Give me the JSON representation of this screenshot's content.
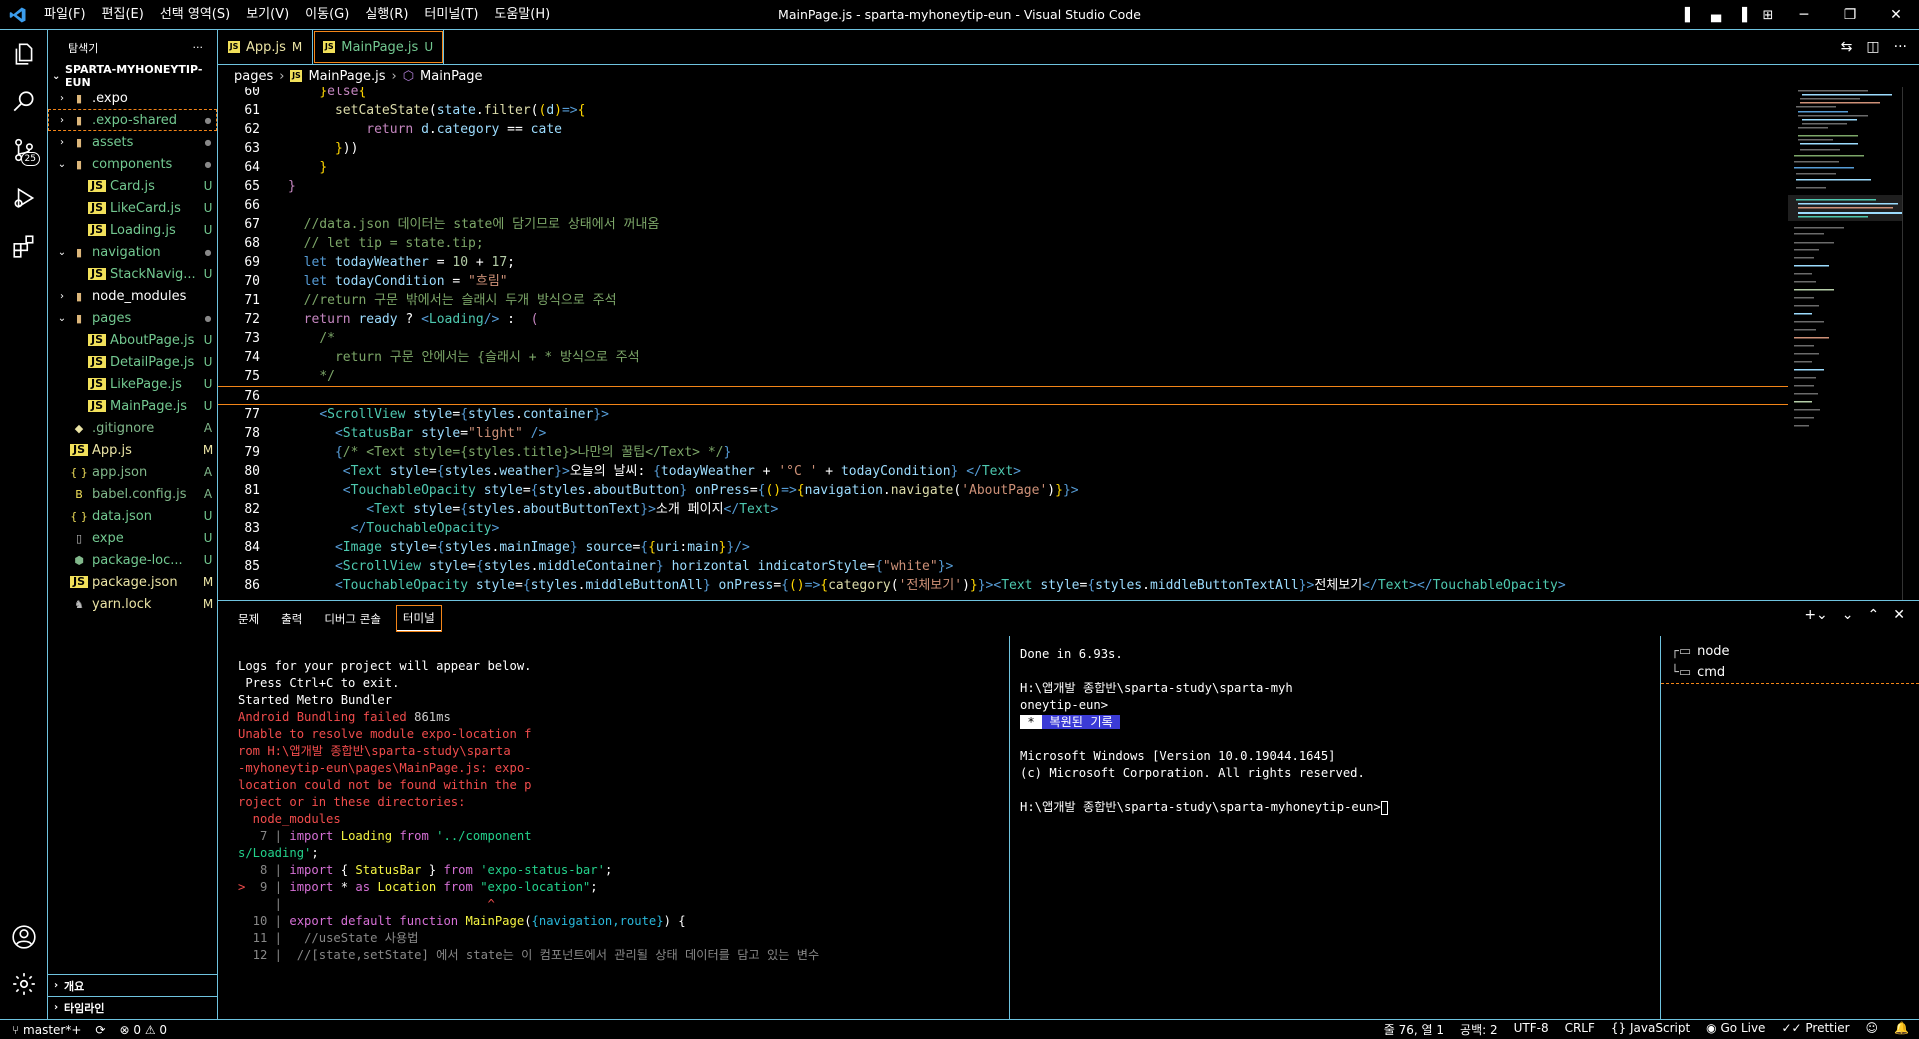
{
  "window": {
    "title": "MainPage.js - sparta-myhoneytip-eun - Visual Studio Code",
    "menu": [
      "파일(F)",
      "편집(E)",
      "선택 영역(S)",
      "보기(V)",
      "이동(G)",
      "실행(R)",
      "터미널(T)",
      "도움말(H)"
    ]
  },
  "activity": {
    "scm_badge": "25"
  },
  "explorer": {
    "title": "탐색기",
    "more": "···",
    "project": "SPARTA-MYHONEYTIP-EUN",
    "items": [
      {
        "name": ".expo",
        "kind": "folder",
        "depth": 0,
        "open": false,
        "status": ""
      },
      {
        "name": ".expo-shared",
        "kind": "folder",
        "depth": 0,
        "open": false,
        "status": "●"
      },
      {
        "name": "assets",
        "kind": "folder",
        "depth": 0,
        "open": false,
        "status": "●"
      },
      {
        "name": "components",
        "kind": "folder",
        "depth": 0,
        "open": true,
        "status": "●"
      },
      {
        "name": "Card.js",
        "kind": "js",
        "depth": 1,
        "status": "U"
      },
      {
        "name": "LikeCard.js",
        "kind": "js",
        "depth": 1,
        "status": "U"
      },
      {
        "name": "Loading.js",
        "kind": "js",
        "depth": 1,
        "status": "U"
      },
      {
        "name": "navigation",
        "kind": "folder",
        "depth": 0,
        "open": true,
        "status": "●"
      },
      {
        "name": "StackNavig...",
        "kind": "js",
        "depth": 1,
        "status": "U"
      },
      {
        "name": "node_modules",
        "kind": "folder",
        "depth": 0,
        "open": false,
        "status": ""
      },
      {
        "name": "pages",
        "kind": "folder",
        "depth": 0,
        "open": true,
        "status": "●"
      },
      {
        "name": "AboutPage.js",
        "kind": "js",
        "depth": 1,
        "status": "U"
      },
      {
        "name": "DetailPage.js",
        "kind": "js",
        "depth": 1,
        "status": "U"
      },
      {
        "name": "LikePage.js",
        "kind": "js",
        "depth": 1,
        "status": "U"
      },
      {
        "name": "MainPage.js",
        "kind": "js",
        "depth": 1,
        "status": "U"
      },
      {
        "name": ".gitignore",
        "kind": "git",
        "depth": 0,
        "status": "A"
      },
      {
        "name": "App.js",
        "kind": "js",
        "depth": 0,
        "status": "M"
      },
      {
        "name": "app.json",
        "kind": "json",
        "depth": 0,
        "status": "A"
      },
      {
        "name": "babel.config.js",
        "kind": "babel",
        "depth": 0,
        "status": "A"
      },
      {
        "name": "data.json",
        "kind": "json",
        "depth": 0,
        "status": "U"
      },
      {
        "name": "expe",
        "kind": "file",
        "depth": 0,
        "status": "U"
      },
      {
        "name": "package-loc...",
        "kind": "npm",
        "depth": 0,
        "status": "U"
      },
      {
        "name": "package.json",
        "kind": "js",
        "depth": 0,
        "status": "M"
      },
      {
        "name": "yarn.lock",
        "kind": "yarn",
        "depth": 0,
        "status": "M"
      }
    ],
    "outline": "개요",
    "timeline": "타임라인"
  },
  "tabs": [
    {
      "name": "App.js",
      "status": "M",
      "active": false
    },
    {
      "name": "MainPage.js",
      "status": "U",
      "active": true
    }
  ],
  "breadcrumb": {
    "folder": "pages",
    "file": "MainPage.js",
    "symbol": "MainPage"
  },
  "terminal": {
    "tabs": [
      "문제",
      "출력",
      "디버그 콘솔",
      "터미널"
    ],
    "active": "터미널",
    "instances": [
      "node",
      "cmd"
    ],
    "restored": "복원된 기록"
  },
  "status": {
    "branch": "master*+",
    "errors": "0",
    "warnings": "0",
    "position": "줄 76, 열 1",
    "spaces": "공백: 2",
    "encoding": "UTF-8",
    "eol": "CRLF",
    "language": "JavaScript",
    "golive": "Go Live",
    "prettier": "Prettier"
  },
  "colors": {
    "accent": "#6fc3df",
    "focus": "#f38518"
  }
}
